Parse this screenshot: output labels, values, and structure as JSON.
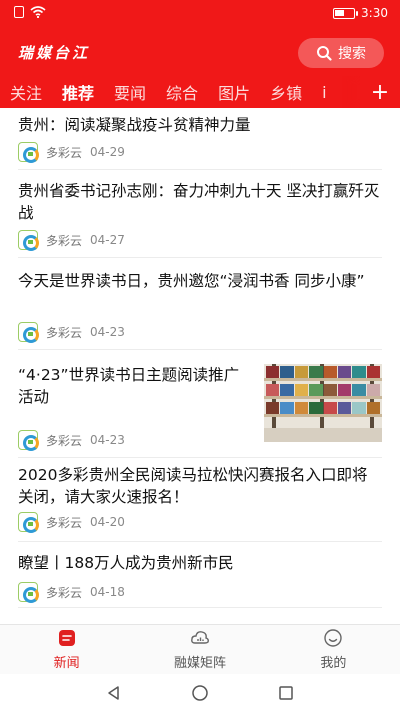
{
  "status": {
    "time": "3:30"
  },
  "header": {
    "logo_text": "瑞媒台江",
    "search_label": "搜索"
  },
  "tabs": [
    {
      "label": "关注"
    },
    {
      "label": "推荐"
    },
    {
      "label": "要闻"
    },
    {
      "label": "综合"
    },
    {
      "label": "图片"
    },
    {
      "label": "乡镇"
    },
    {
      "label": "i"
    }
  ],
  "tabs_more": "+",
  "feed": [
    {
      "title": "贵州：阅读凝聚战疫斗贫精神力量",
      "source": "多彩云",
      "date": "04-29"
    },
    {
      "title": "贵州省委书记孙志刚：奋力冲刺九十天 坚决打赢歼灭战",
      "source": "多彩云",
      "date": "04-27"
    },
    {
      "title": "今天是世界读书日，贵州邀您“浸润书香 同步小康”",
      "source": "多彩云",
      "date": "04-23"
    },
    {
      "title": "“4·23”世界读书日主题阅读推广活动",
      "source": "多彩云",
      "date": "04-23"
    },
    {
      "title": "2020多彩贵州全民阅读马拉松快闪赛报名入口即将关闭，请大家火速报名！",
      "source": "多彩云",
      "date": "04-20"
    },
    {
      "title": "瞭望丨188万人成为贵州新市民",
      "source": "多彩云",
      "date": "04-18"
    }
  ],
  "bottom_tabs": [
    {
      "label": "新闻"
    },
    {
      "label": "融媒矩阵"
    },
    {
      "label": "我的"
    }
  ],
  "colors": {
    "brand_red": "#f01818",
    "active_red": "#e02020"
  },
  "icons": [
    "wifi-icon",
    "sim-icon",
    "battery-icon",
    "search-icon",
    "source-icon",
    "news-icon",
    "media-matrix-icon",
    "profile-icon",
    "back-icon",
    "home-icon",
    "recents-icon"
  ]
}
